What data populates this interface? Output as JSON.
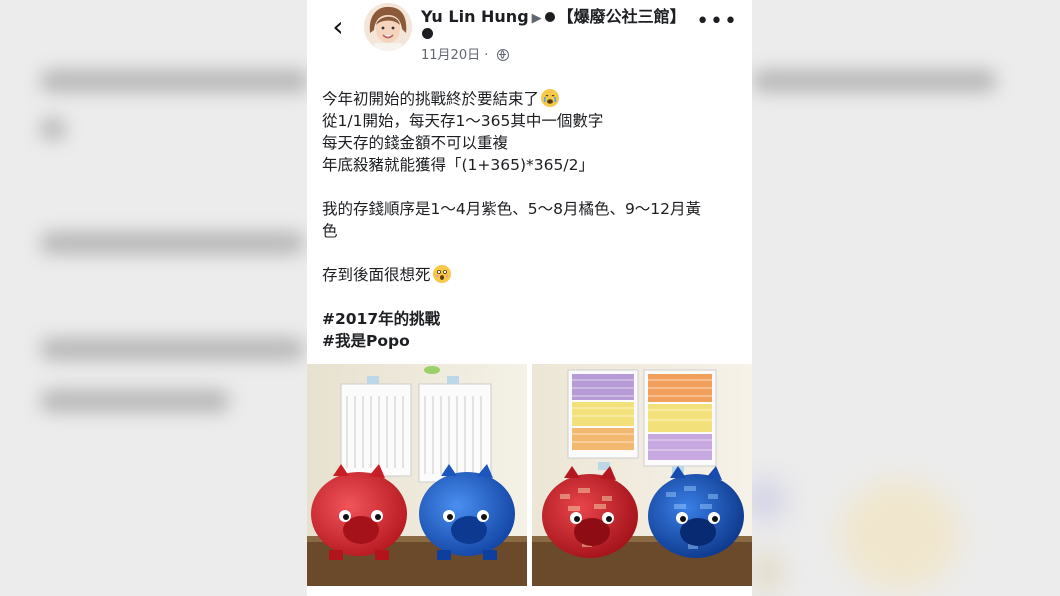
{
  "post": {
    "author": "Yu Lin Hung",
    "arrow": "▶",
    "group": "【爆廢公社三館】",
    "date": "11月20日",
    "sep": "·",
    "more": "•••",
    "back": "‹"
  },
  "body": {
    "line1": "今年初開始的挑戰終於要結束了",
    "line2": "從1/1開始，每天存1～365其中一個數字",
    "line3": "每天存的錢金額不可以重複",
    "line4": "年底殺豬就能獲得「(1+365)*365/2」",
    "line5": "我的存錢順序是1～4月紫色、5～8月橘色、9～12月黃",
    "line6": "色",
    "line7": "存到後面很想死",
    "tag1": "#2017年的挑戰",
    "tag2": "#我是Popo"
  },
  "icons": {
    "back": "back-chevron-icon",
    "globe": "globe-icon",
    "more": "more-dots-icon",
    "cry": "crying-face-emoji",
    "shock": "astonished-face-emoji"
  },
  "colors": {
    "text": "#1c1e21",
    "muted": "#606770",
    "piggy_red": "#d8252e",
    "piggy_blue": "#1b5fc9"
  }
}
